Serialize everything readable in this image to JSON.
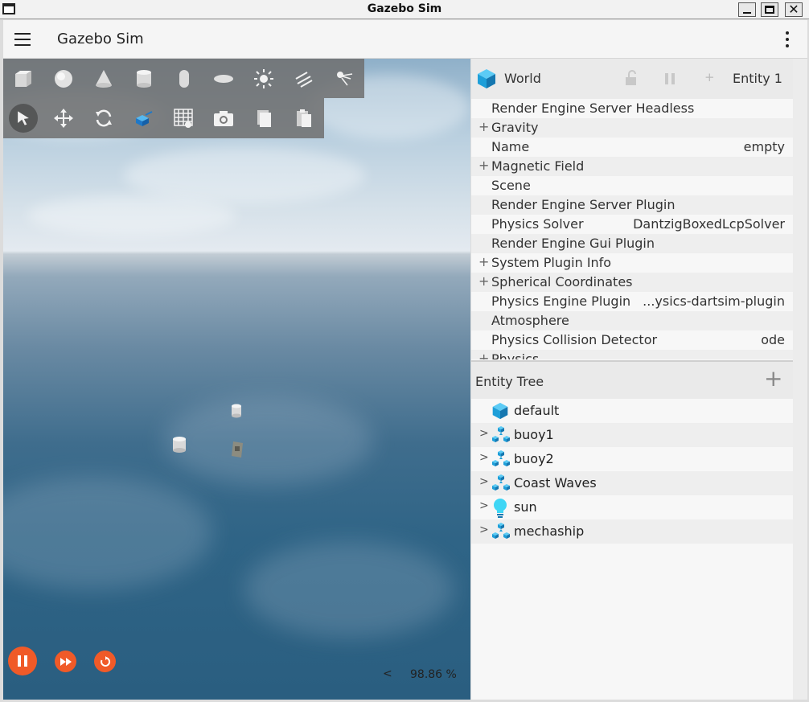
{
  "window": {
    "title": "Gazebo Sim"
  },
  "app": {
    "title": "Gazebo Sim"
  },
  "viewport": {
    "real_time_factor": "98.86 %",
    "rtf_toggle": "<"
  },
  "component_inspector": {
    "header": {
      "entity_label": "World",
      "entity_id": "Entity 1",
      "add_label": "+"
    },
    "properties": [
      {
        "expand": "",
        "name": "Render Engine Server Headless",
        "value": ""
      },
      {
        "expand": "+",
        "name": "Gravity",
        "value": ""
      },
      {
        "expand": "",
        "name": "Name",
        "value": "empty"
      },
      {
        "expand": "+",
        "name": "Magnetic Field",
        "value": ""
      },
      {
        "expand": "",
        "name": "Scene",
        "value": ""
      },
      {
        "expand": "",
        "name": "Render Engine Server Plugin",
        "value": ""
      },
      {
        "expand": "",
        "name": "Physics Solver",
        "value": "DantzigBoxedLcpSolver"
      },
      {
        "expand": "",
        "name": "Render Engine Gui Plugin",
        "value": ""
      },
      {
        "expand": "+",
        "name": "System Plugin Info",
        "value": ""
      },
      {
        "expand": "+",
        "name": "Spherical Coordinates",
        "value": ""
      },
      {
        "expand": "",
        "name": "Physics Engine Plugin",
        "value": "...ysics-dartsim-plugin"
      },
      {
        "expand": "",
        "name": "Atmosphere",
        "value": ""
      },
      {
        "expand": "",
        "name": "Physics Collision Detector",
        "value": "ode"
      },
      {
        "expand": "+",
        "name": "Physics",
        "value": ""
      }
    ]
  },
  "entity_tree": {
    "title": "Entity Tree",
    "add_label": "+",
    "items": [
      {
        "chevron": "",
        "name": "default",
        "icon": "cube-icon"
      },
      {
        "chevron": ">",
        "name": "buoy1",
        "icon": "model-icon"
      },
      {
        "chevron": ">",
        "name": "buoy2",
        "icon": "model-icon"
      },
      {
        "chevron": ">",
        "name": "Coast Waves",
        "icon": "model-icon"
      },
      {
        "chevron": ">",
        "name": "sun",
        "icon": "light-bulb-icon"
      },
      {
        "chevron": ">",
        "name": "mechaship",
        "icon": "model-icon"
      }
    ]
  },
  "colors": {
    "accent": "#f05a28",
    "cube_blue": "#1e9fd9"
  }
}
